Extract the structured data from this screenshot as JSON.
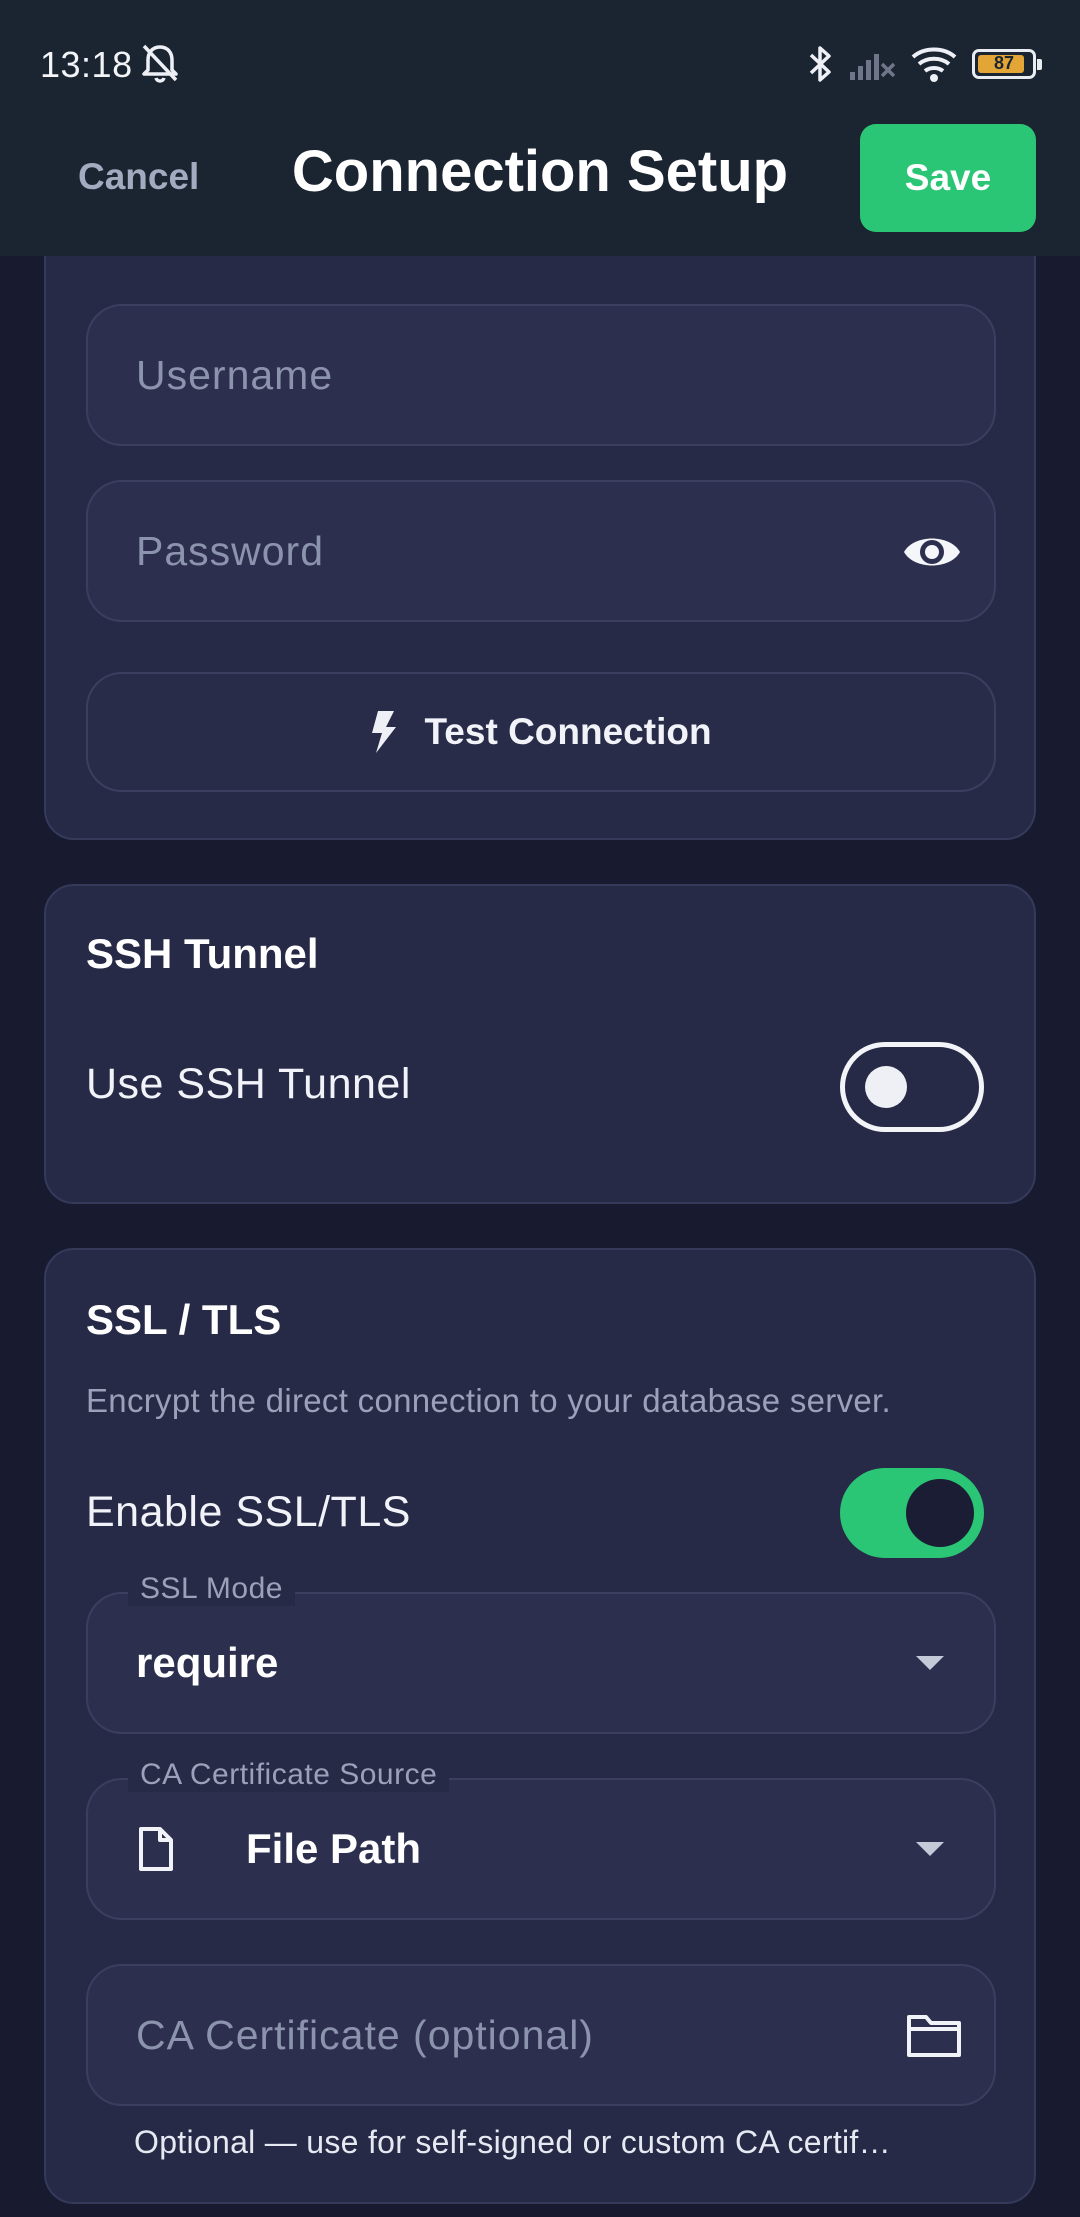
{
  "status_bar": {
    "time": "13:18",
    "battery": "87",
    "icons": [
      "bell-off-icon",
      "bluetooth-icon",
      "signal-off-icon",
      "wifi-icon",
      "battery-icon"
    ]
  },
  "app_bar": {
    "cancel": "Cancel",
    "title": "Connection Setup",
    "save": "Save"
  },
  "auth": {
    "username_placeholder": "Username",
    "password_placeholder": "Password",
    "test_connection": "Test Connection"
  },
  "ssh": {
    "title": "SSH Tunnel",
    "use_label": "Use SSH Tunnel",
    "enabled": false
  },
  "ssl": {
    "title": "SSL / TLS",
    "description": "Encrypt the direct connection to your database server.",
    "enable_label": "Enable SSL/TLS",
    "enabled": true,
    "mode_label": "SSL Mode",
    "mode_value": "require",
    "ca_source_label": "CA Certificate Source",
    "ca_source_value": "File Path",
    "ca_cert_placeholder": "CA Certificate (optional)",
    "ca_cert_helper": "Optional — use for self-signed or custom CA certif…"
  },
  "colors": {
    "accent_green": "#2bc675",
    "background": "#181b30",
    "card": "#262a47",
    "app_bar": "#1b2532"
  }
}
